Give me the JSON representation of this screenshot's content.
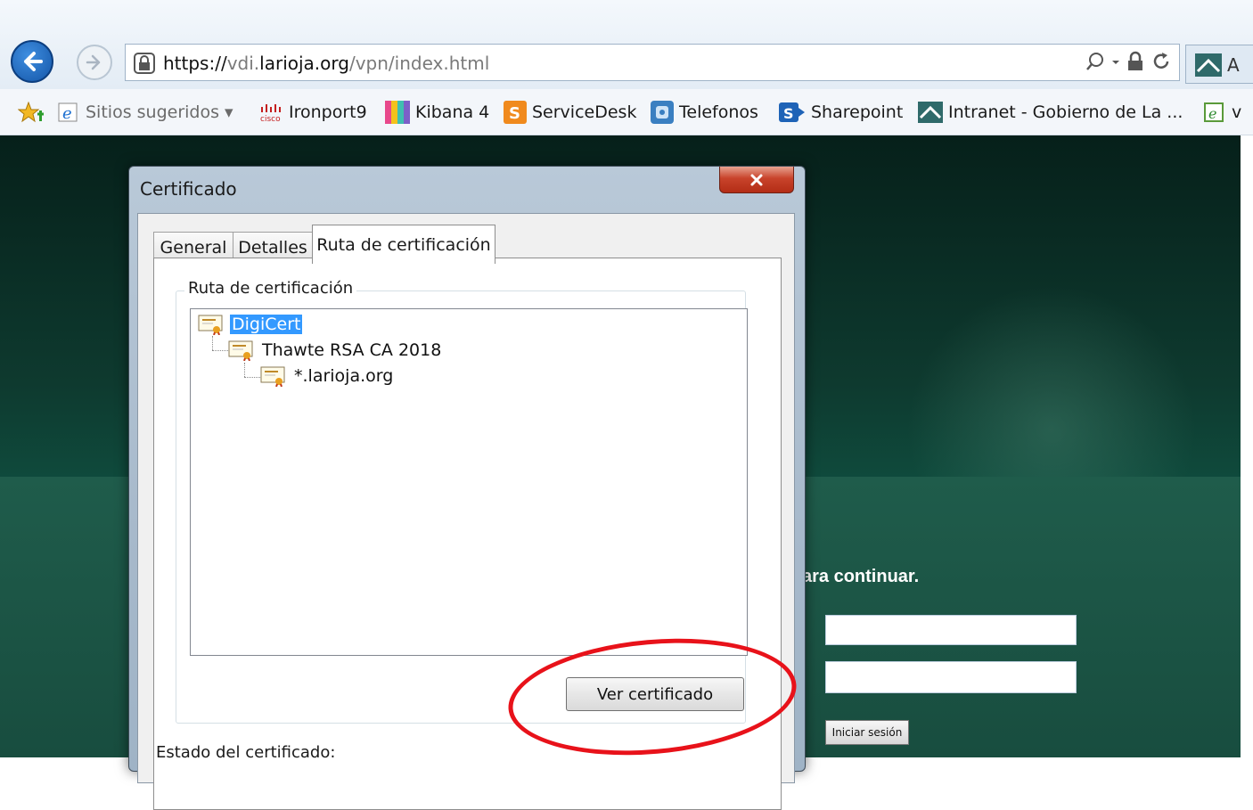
{
  "browser": {
    "url_scheme": "https://",
    "url_sub": "vdi.",
    "url_domain": "larioja.org",
    "url_path": "/vpn/index.html",
    "tab_partial_label": "A",
    "favorites": [
      {
        "label": "Sitios sugeridos ▾",
        "icon": "ie-icon"
      },
      {
        "label": "Ironport9",
        "icon": "cisco-icon"
      },
      {
        "label": "Kibana 4",
        "icon": "kibana-icon"
      },
      {
        "label": "ServiceDesk",
        "icon": "servicedesk-icon"
      },
      {
        "label": "Telefonos",
        "icon": "phone-icon"
      },
      {
        "label": "Sharepoint",
        "icon": "sharepoint-icon"
      },
      {
        "label": "Intranet - Gobierno de La ...",
        "icon": "intranet-icon"
      },
      {
        "label": "v",
        "icon": "ie-page-icon"
      }
    ]
  },
  "page": {
    "login_prompt": "ara continuar.",
    "login_button": "Iniciar sesión"
  },
  "dialog": {
    "title": "Certificado",
    "tabs": [
      "General",
      "Detalles",
      "Ruta de certificación"
    ],
    "active_tab": "Ruta de certificación",
    "group_label": "Ruta de certificación",
    "tree": [
      "DigiCert",
      "Thawte RSA CA 2018",
      "*.larioja.org"
    ],
    "selected_node": "DigiCert",
    "view_button": "Ver certificado",
    "status_label": "Estado del certificado:"
  },
  "colors": {
    "selection": "#3399ff",
    "annotation": "#e8121a",
    "page_green": "#0f4a3c"
  }
}
